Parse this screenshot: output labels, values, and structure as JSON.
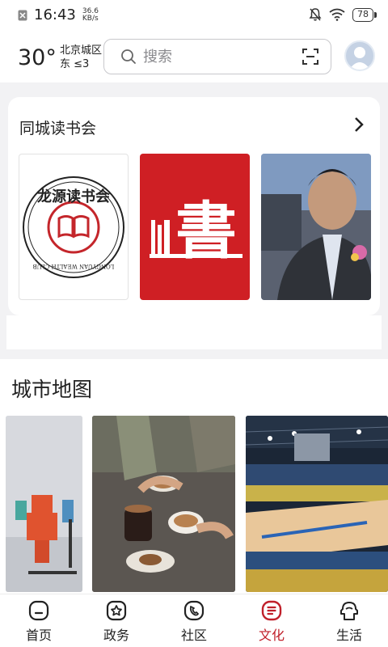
{
  "status_bar": {
    "time": "16:43",
    "net_speed_value": "36.6",
    "net_speed_unit": "KB/s",
    "battery": "78"
  },
  "header": {
    "temperature": "30°",
    "district": "北京城区",
    "wind": "东 ≤3",
    "search_placeholder": "搜索"
  },
  "book_club": {
    "title": "同城读书会",
    "logo_text": "龙源读书会",
    "logo_subtext": "LONGYUAN WEALTH CLUB",
    "book_char": "書"
  },
  "city_map": {
    "title": "城市地图"
  },
  "nav": [
    {
      "label": "首页",
      "icon": "home-icon"
    },
    {
      "label": "政务",
      "icon": "government-icon"
    },
    {
      "label": "社区",
      "icon": "community-icon"
    },
    {
      "label": "文化",
      "icon": "culture-icon",
      "active": true
    },
    {
      "label": "生活",
      "icon": "life-icon"
    }
  ],
  "colors": {
    "accent": "#c0202a",
    "book_red": "#cf1f24"
  }
}
